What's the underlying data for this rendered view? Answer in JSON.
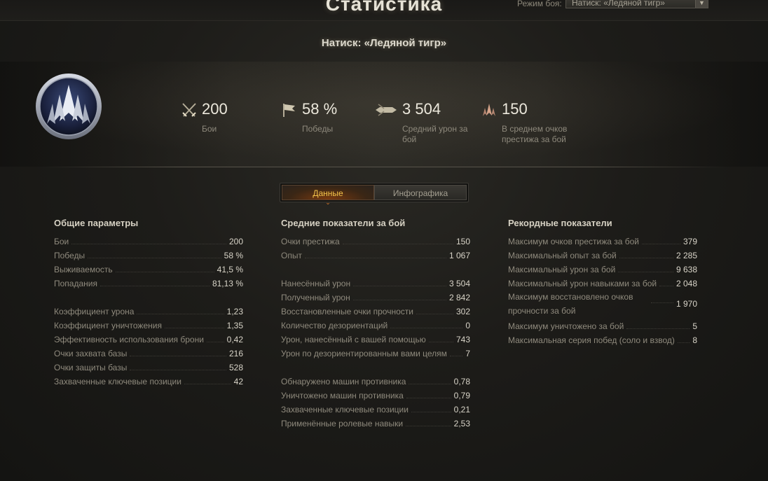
{
  "header": {
    "title": "Статистика",
    "mode_label": "Режим боя:",
    "mode_value": "Натиск: «Ледяной тигр»"
  },
  "subtitle": "Натиск: «Ледяной тигр»",
  "summary": [
    {
      "value": "200",
      "label": "Бои",
      "icon": "crossed-swords-icon"
    },
    {
      "value": "58 %",
      "label": "Победы",
      "icon": "flag-icon"
    },
    {
      "value": "3 504",
      "label": "Средний урон за бой",
      "icon": "shell-icon"
    },
    {
      "value": "150",
      "label": "В среднем очков престижа за бой",
      "icon": "prestige-icon"
    }
  ],
  "tabs": [
    {
      "label": "Данные",
      "active": true
    },
    {
      "label": "Инфографика",
      "active": false
    }
  ],
  "columns": [
    {
      "title": "Общие параметры",
      "rows": [
        {
          "label": "Бои",
          "value": "200"
        },
        {
          "label": "Победы",
          "value": "58 %"
        },
        {
          "label": "Выживаемость",
          "value": "41,5 %"
        },
        {
          "label": "Попадания",
          "value": "81,13 %"
        },
        null,
        {
          "label": "Коэффициент урона",
          "value": "1,23"
        },
        {
          "label": "Коэффициент уничтожения",
          "value": "1,35"
        },
        {
          "label": "Эффективность использования брони",
          "value": "0,42"
        },
        {
          "label": "Очки захвата базы",
          "value": "216"
        },
        {
          "label": "Очки защиты базы",
          "value": "528"
        },
        {
          "label": "Захваченные ключевые позиции",
          "value": "42"
        }
      ]
    },
    {
      "title": "Средние показатели за бой",
      "rows": [
        {
          "label": "Очки престижа",
          "value": "150"
        },
        {
          "label": "Опыт",
          "value": "1 067"
        },
        null,
        {
          "label": "Нанесённый урон",
          "value": "3 504"
        },
        {
          "label": "Полученный урон",
          "value": "2 842"
        },
        {
          "label": "Восстановленные очки прочности",
          "value": "302"
        },
        {
          "label": "Количество дезориентаций",
          "value": "0"
        },
        {
          "label": "Урон, нанесённый с вашей помощью",
          "value": "743"
        },
        {
          "label": "Урон по дезориентированным вами целям",
          "value": "7"
        },
        null,
        {
          "label": "Обнаружено машин противника",
          "value": "0,78"
        },
        {
          "label": "Уничтожено машин противника",
          "value": "0,79"
        },
        {
          "label": "Захваченные ключевые позиции",
          "value": "0,21"
        },
        {
          "label": "Применённые ролевые навыки",
          "value": "2,53"
        }
      ]
    },
    {
      "title": "Рекордные показатели",
      "rows": [
        {
          "label": "Максимум очков престижа за бой",
          "value": "379"
        },
        {
          "label": "Максимальный опыт за бой",
          "value": "2 285"
        },
        {
          "label": "Максимальный урон за бой",
          "value": "9 638"
        },
        {
          "label": "Максимальный урон навыками за бой",
          "value": "2 048"
        },
        {
          "label": "Максимум восстановлено очков прочности за бой",
          "value": "1 970",
          "tall": true
        },
        {
          "label": "Максимум уничтожено за бой",
          "value": "5"
        },
        {
          "label": "Максимальная серия побед (соло и взвод)",
          "value": "8"
        }
      ]
    }
  ],
  "colors": {
    "accent": "#f3c34a",
    "background": "#1d1c19",
    "text_value": "#d8d4c8",
    "text_label": "#8f8a7d"
  }
}
